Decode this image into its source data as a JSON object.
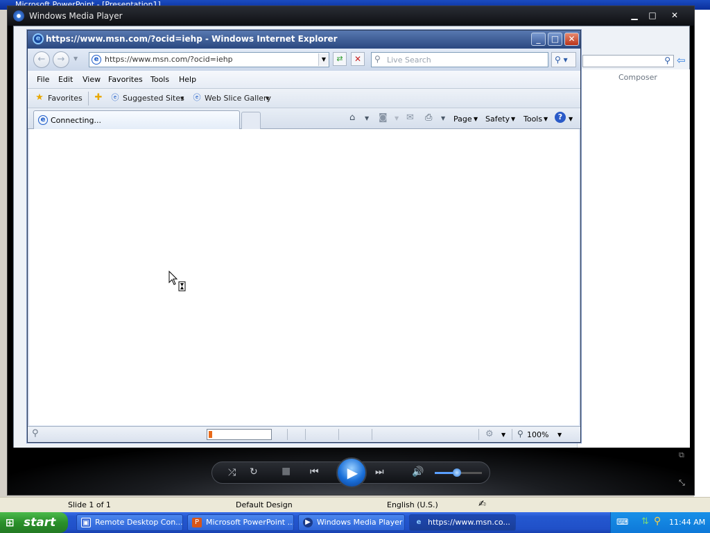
{
  "powerpoint": {
    "title": "Microsoft PowerPoint - [Presentation1]",
    "status": {
      "slide": "Slide 1 of 1",
      "design": "Default Design",
      "language": "English (U.S.)"
    }
  },
  "wmp": {
    "title": "Windows Media Player",
    "column_header": "Composer",
    "window_controls": {
      "minimize": "▁",
      "maximize": "□",
      "close": "✕"
    },
    "volume_level": 0.48
  },
  "ie": {
    "title": "https://www.msn.com/?ocid=iehp - Windows Internet Explorer",
    "address": "https://www.msn.com/?ocid=iehp",
    "search_placeholder": "Live Search",
    "menu": [
      "File",
      "Edit",
      "View",
      "Favorites",
      "Tools",
      "Help"
    ],
    "favorites_label": "Favorites",
    "favorites_links": [
      "Suggested Sites",
      "Web Slice Gallery"
    ],
    "tab_title": "Connecting...",
    "commands": [
      "Page",
      "Safety",
      "Tools"
    ],
    "zoom": "100%",
    "progress": 0.06
  },
  "taskbar": {
    "start_label": "start",
    "items": [
      {
        "label": "Remote Desktop Con...",
        "icon": "remote-desktop-icon"
      },
      {
        "label": "Microsoft PowerPoint ...",
        "icon": "powerpoint-icon"
      },
      {
        "label": "Windows Media Player",
        "icon": "media-player-icon"
      },
      {
        "label": "https://www.msn.co...",
        "icon": "ie-icon"
      }
    ],
    "clock": "11:44 AM"
  },
  "colors": {
    "xp_taskbar": "#2458d0",
    "start_green": "#2a902a",
    "ie_titlebar": "#2a4880",
    "progress_orange": "#e86a1a"
  }
}
